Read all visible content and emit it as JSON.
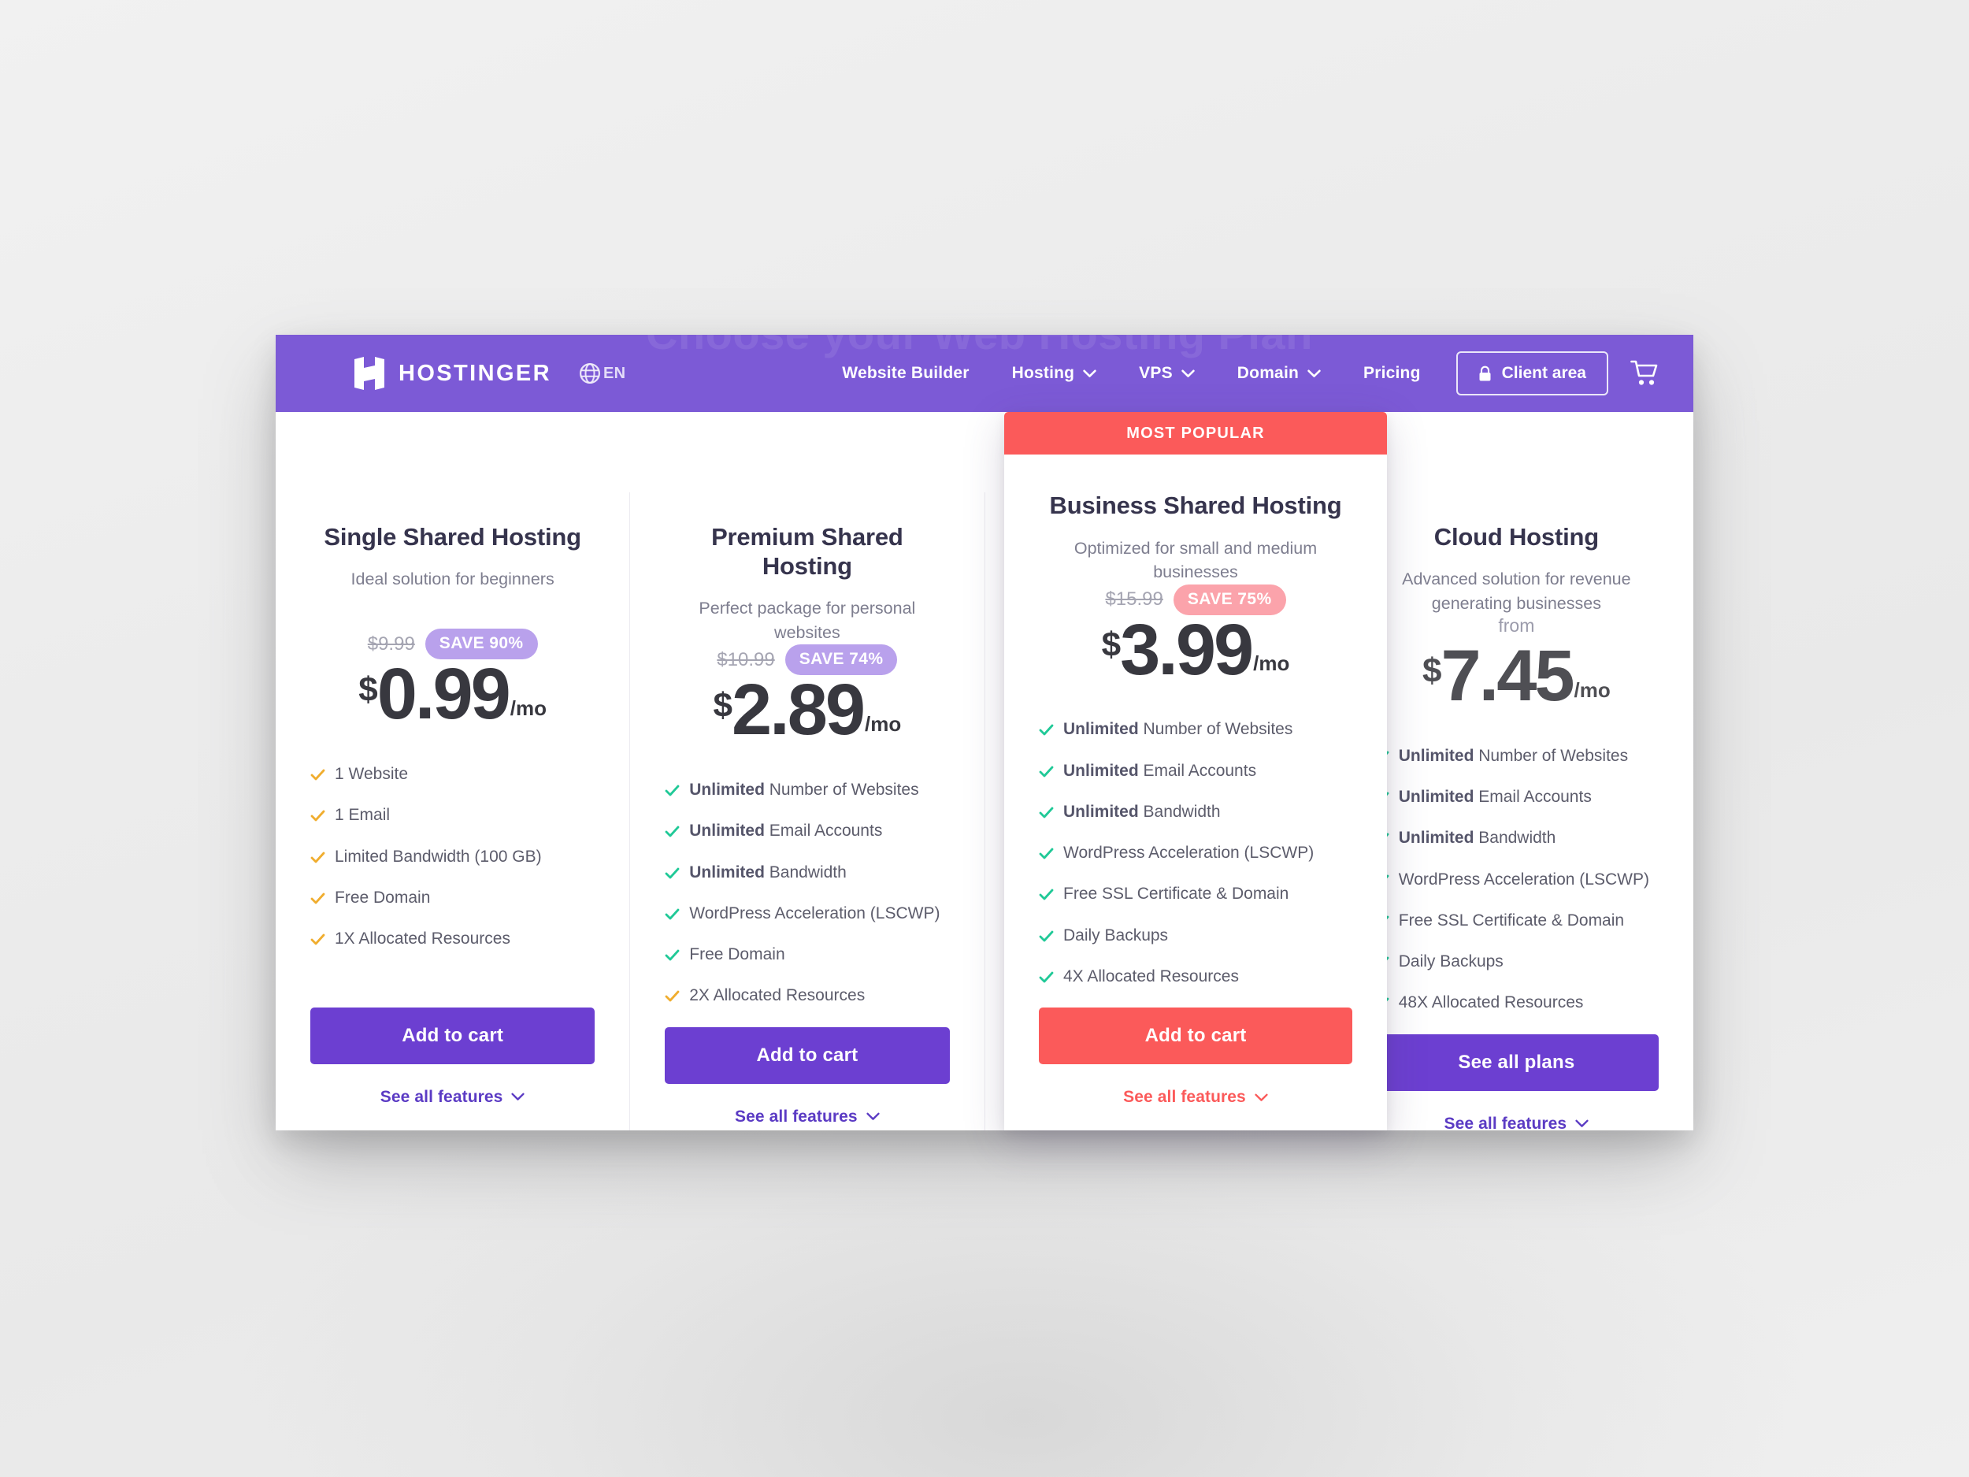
{
  "brand": {
    "name": "HOSTINGER",
    "logo_icon": "hostinger-h-logo",
    "language_icon": "globe-icon",
    "language": "EN"
  },
  "nav": {
    "watermark": "Choose your Web Hosting Plan",
    "items": [
      {
        "label": "Website Builder",
        "has_dropdown": false
      },
      {
        "label": "Hosting",
        "has_dropdown": true
      },
      {
        "label": "VPS",
        "has_dropdown": true
      },
      {
        "label": "Domain",
        "has_dropdown": true
      },
      {
        "label": "Pricing",
        "has_dropdown": false
      }
    ],
    "client_area": {
      "label": "Client area",
      "icon": "lock-icon"
    },
    "cart": {
      "icon": "shopping-cart-icon"
    }
  },
  "colors": {
    "header_purple": "#7c5ad6",
    "cta_purple": "#6c3fd1",
    "accent_red": "#fb5a5a",
    "save_pill_purple": "#b9a1ec",
    "save_pill_red": "#fba3ab",
    "tick_green": "#20c997",
    "tick_amber": "#f0ad2e",
    "page_background": "#ececec"
  },
  "plans": [
    {
      "title": "Single Shared Hosting",
      "subtitle": "Ideal solution for beginners",
      "from_label": "",
      "old_price": "$9.99",
      "save_badge": "SAVE 90%",
      "save_style": "purple",
      "currency": "$",
      "price": "0.99",
      "period": "/mo",
      "tick_color": "amber",
      "features": [
        {
          "bold": "",
          "text": "1 Website"
        },
        {
          "bold": "",
          "text": "1 Email"
        },
        {
          "bold": "",
          "text": "Limited Bandwidth (100 GB)"
        },
        {
          "bold": "",
          "text": "Free Domain"
        },
        {
          "bold": "",
          "text": "1X Allocated Resources"
        }
      ],
      "cta": "Add to cart",
      "cta_style": "purple",
      "see_all": "See all features",
      "featured": false,
      "badge": ""
    },
    {
      "title": "Premium Shared Hosting",
      "subtitle": "Perfect package for personal websites",
      "from_label": "",
      "old_price": "$10.99",
      "save_badge": "SAVE 74%",
      "save_style": "purple",
      "currency": "$",
      "price": "2.89",
      "period": "/mo",
      "tick_color": "green",
      "features": [
        {
          "bold": "Unlimited",
          "text": " Number of Websites"
        },
        {
          "bold": "Unlimited",
          "text": " Email Accounts"
        },
        {
          "bold": "Unlimited",
          "text": " Bandwidth"
        },
        {
          "bold": "",
          "text": "WordPress Acceleration (LSCWP)"
        },
        {
          "bold": "",
          "text": "Free Domain"
        },
        {
          "bold": "",
          "text": "2X Allocated Resources"
        }
      ],
      "cta": "Add to cart",
      "cta_style": "purple",
      "see_all": "See all features",
      "featured": false,
      "badge": ""
    },
    {
      "title": "Business Shared Hosting",
      "subtitle": "Optimized for small and medium businesses",
      "from_label": "",
      "old_price": "$15.99",
      "save_badge": "SAVE 75%",
      "save_style": "red",
      "currency": "$",
      "price": "3.99",
      "period": "/mo",
      "tick_color": "green",
      "features": [
        {
          "bold": "Unlimited",
          "text": " Number of Websites"
        },
        {
          "bold": "Unlimited",
          "text": " Email Accounts"
        },
        {
          "bold": "Unlimited",
          "text": " Bandwidth"
        },
        {
          "bold": "",
          "text": "WordPress Acceleration (LSCWP)"
        },
        {
          "bold": "",
          "text": "Free SSL Certificate & Domain"
        },
        {
          "bold": "",
          "text": "Daily Backups"
        },
        {
          "bold": "",
          "text": "4X Allocated Resources"
        }
      ],
      "cta": "Add to cart",
      "cta_style": "red",
      "see_all": "See all features",
      "featured": true,
      "badge": "MOST POPULAR"
    },
    {
      "title": "Cloud Hosting",
      "subtitle": "Advanced solution for revenue generating businesses",
      "from_label": "from",
      "old_price": "",
      "save_badge": "",
      "save_style": "",
      "currency": "$",
      "price": "7.45",
      "period": "/mo",
      "tick_color": "green",
      "features": [
        {
          "bold": "Unlimited",
          "text": " Number of Websites"
        },
        {
          "bold": "Unlimited",
          "text": " Email Accounts"
        },
        {
          "bold": "Unlimited",
          "text": " Bandwidth"
        },
        {
          "bold": "",
          "text": "WordPress Acceleration (LSCWP)"
        },
        {
          "bold": "",
          "text": "Free SSL Certificate & Domain"
        },
        {
          "bold": "",
          "text": "Daily Backups"
        },
        {
          "bold": "",
          "text": "48X Allocated Resources"
        }
      ],
      "cta": "See all plans",
      "cta_style": "purple",
      "see_all": "See all features",
      "featured": false,
      "badge": ""
    }
  ]
}
